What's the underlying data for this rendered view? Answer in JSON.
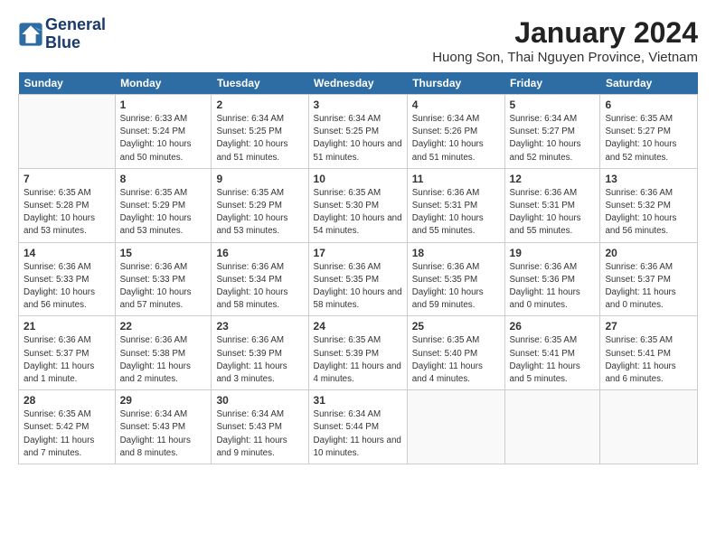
{
  "logo": {
    "line1": "General",
    "line2": "Blue"
  },
  "title": "January 2024",
  "location": "Huong Son, Thai Nguyen Province, Vietnam",
  "weekdays": [
    "Sunday",
    "Monday",
    "Tuesday",
    "Wednesday",
    "Thursday",
    "Friday",
    "Saturday"
  ],
  "weeks": [
    [
      {
        "day": "",
        "info": ""
      },
      {
        "day": "1",
        "info": "Sunrise: 6:33 AM\nSunset: 5:24 PM\nDaylight: 10 hours\nand 50 minutes."
      },
      {
        "day": "2",
        "info": "Sunrise: 6:34 AM\nSunset: 5:25 PM\nDaylight: 10 hours\nand 51 minutes."
      },
      {
        "day": "3",
        "info": "Sunrise: 6:34 AM\nSunset: 5:25 PM\nDaylight: 10 hours\nand 51 minutes."
      },
      {
        "day": "4",
        "info": "Sunrise: 6:34 AM\nSunset: 5:26 PM\nDaylight: 10 hours\nand 51 minutes."
      },
      {
        "day": "5",
        "info": "Sunrise: 6:34 AM\nSunset: 5:27 PM\nDaylight: 10 hours\nand 52 minutes."
      },
      {
        "day": "6",
        "info": "Sunrise: 6:35 AM\nSunset: 5:27 PM\nDaylight: 10 hours\nand 52 minutes."
      }
    ],
    [
      {
        "day": "7",
        "info": "Sunrise: 6:35 AM\nSunset: 5:28 PM\nDaylight: 10 hours\nand 53 minutes."
      },
      {
        "day": "8",
        "info": "Sunrise: 6:35 AM\nSunset: 5:29 PM\nDaylight: 10 hours\nand 53 minutes."
      },
      {
        "day": "9",
        "info": "Sunrise: 6:35 AM\nSunset: 5:29 PM\nDaylight: 10 hours\nand 53 minutes."
      },
      {
        "day": "10",
        "info": "Sunrise: 6:35 AM\nSunset: 5:30 PM\nDaylight: 10 hours\nand 54 minutes."
      },
      {
        "day": "11",
        "info": "Sunrise: 6:36 AM\nSunset: 5:31 PM\nDaylight: 10 hours\nand 55 minutes."
      },
      {
        "day": "12",
        "info": "Sunrise: 6:36 AM\nSunset: 5:31 PM\nDaylight: 10 hours\nand 55 minutes."
      },
      {
        "day": "13",
        "info": "Sunrise: 6:36 AM\nSunset: 5:32 PM\nDaylight: 10 hours\nand 56 minutes."
      }
    ],
    [
      {
        "day": "14",
        "info": "Sunrise: 6:36 AM\nSunset: 5:33 PM\nDaylight: 10 hours\nand 56 minutes."
      },
      {
        "day": "15",
        "info": "Sunrise: 6:36 AM\nSunset: 5:33 PM\nDaylight: 10 hours\nand 57 minutes."
      },
      {
        "day": "16",
        "info": "Sunrise: 6:36 AM\nSunset: 5:34 PM\nDaylight: 10 hours\nand 58 minutes."
      },
      {
        "day": "17",
        "info": "Sunrise: 6:36 AM\nSunset: 5:35 PM\nDaylight: 10 hours\nand 58 minutes."
      },
      {
        "day": "18",
        "info": "Sunrise: 6:36 AM\nSunset: 5:35 PM\nDaylight: 10 hours\nand 59 minutes."
      },
      {
        "day": "19",
        "info": "Sunrise: 6:36 AM\nSunset: 5:36 PM\nDaylight: 11 hours\nand 0 minutes."
      },
      {
        "day": "20",
        "info": "Sunrise: 6:36 AM\nSunset: 5:37 PM\nDaylight: 11 hours\nand 0 minutes."
      }
    ],
    [
      {
        "day": "21",
        "info": "Sunrise: 6:36 AM\nSunset: 5:37 PM\nDaylight: 11 hours\nand 1 minute."
      },
      {
        "day": "22",
        "info": "Sunrise: 6:36 AM\nSunset: 5:38 PM\nDaylight: 11 hours\nand 2 minutes."
      },
      {
        "day": "23",
        "info": "Sunrise: 6:36 AM\nSunset: 5:39 PM\nDaylight: 11 hours\nand 3 minutes."
      },
      {
        "day": "24",
        "info": "Sunrise: 6:35 AM\nSunset: 5:39 PM\nDaylight: 11 hours\nand 4 minutes."
      },
      {
        "day": "25",
        "info": "Sunrise: 6:35 AM\nSunset: 5:40 PM\nDaylight: 11 hours\nand 4 minutes."
      },
      {
        "day": "26",
        "info": "Sunrise: 6:35 AM\nSunset: 5:41 PM\nDaylight: 11 hours\nand 5 minutes."
      },
      {
        "day": "27",
        "info": "Sunrise: 6:35 AM\nSunset: 5:41 PM\nDaylight: 11 hours\nand 6 minutes."
      }
    ],
    [
      {
        "day": "28",
        "info": "Sunrise: 6:35 AM\nSunset: 5:42 PM\nDaylight: 11 hours\nand 7 minutes."
      },
      {
        "day": "29",
        "info": "Sunrise: 6:34 AM\nSunset: 5:43 PM\nDaylight: 11 hours\nand 8 minutes."
      },
      {
        "day": "30",
        "info": "Sunrise: 6:34 AM\nSunset: 5:43 PM\nDaylight: 11 hours\nand 9 minutes."
      },
      {
        "day": "31",
        "info": "Sunrise: 6:34 AM\nSunset: 5:44 PM\nDaylight: 11 hours\nand 10 minutes."
      },
      {
        "day": "",
        "info": ""
      },
      {
        "day": "",
        "info": ""
      },
      {
        "day": "",
        "info": ""
      }
    ]
  ]
}
